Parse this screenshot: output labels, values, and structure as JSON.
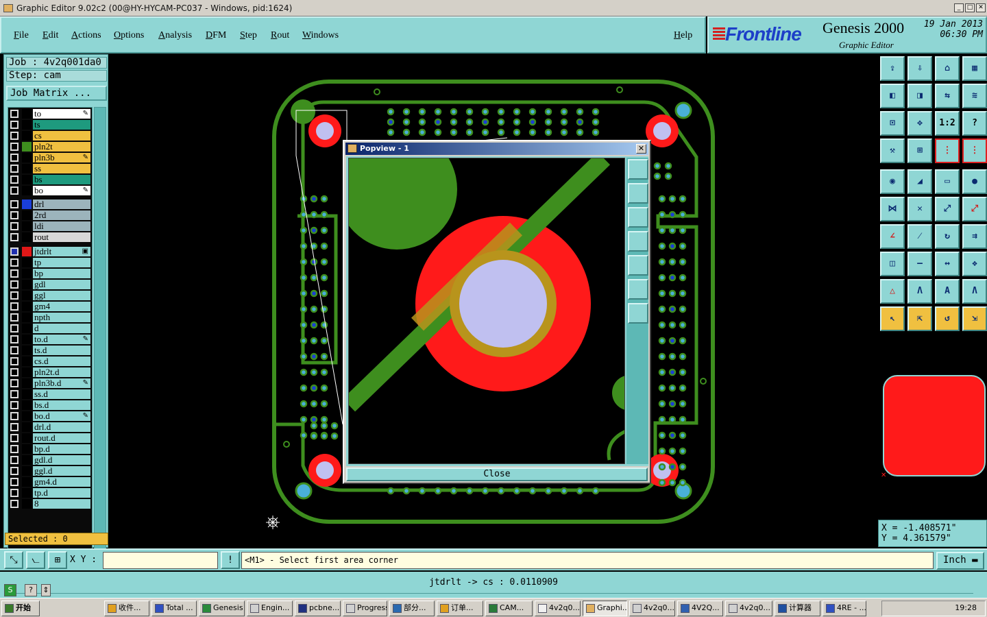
{
  "window": {
    "title": "Graphic Editor 9.02c2 (00@HY-HYCAM-PC037 - Windows, pid:1624)"
  },
  "menu": {
    "items": [
      "File",
      "Edit",
      "Actions",
      "Options",
      "Analysis",
      "DFM",
      "Step",
      "Rout",
      "Windows"
    ],
    "help": "Help"
  },
  "brand": {
    "logo": "Frontline",
    "product": "Genesis 2000",
    "subtitle": "Graphic Editor",
    "date": "19 Jan 2013",
    "time": "06:30 PM"
  },
  "job": {
    "job_label": "Job : 4v2q001da0",
    "step_label": "Step: cam",
    "matrix_button": "Job Matrix ..."
  },
  "layers": [
    {
      "name": "to",
      "color": "#ffffff",
      "mark": "pen"
    },
    {
      "name": "ts",
      "color": "#1e9a7e",
      "mark": ""
    },
    {
      "name": "cs",
      "color": "#f0c040",
      "mark": ""
    },
    {
      "name": "pln2t",
      "color": "#f0c040",
      "mark": "",
      "swatch": "#3e8e1e"
    },
    {
      "name": "pln3b",
      "color": "#f0c040",
      "mark": "pen"
    },
    {
      "name": "ss",
      "color": "#f0c040",
      "mark": ""
    },
    {
      "name": "bs",
      "color": "#1e9a7e",
      "mark": ""
    },
    {
      "name": "bo",
      "color": "#ffffff",
      "mark": "pen"
    },
    {
      "name": "drl",
      "color": "#9cb4bc",
      "mark": "",
      "swatch": "#1a3ed8"
    },
    {
      "name": "2rd",
      "color": "#9cb4bc",
      "mark": ""
    },
    {
      "name": "ldi",
      "color": "#9cb4bc",
      "mark": ""
    },
    {
      "name": "rout",
      "color": "#d8d8d8",
      "mark": ""
    },
    {
      "name": "jtdrlt",
      "color": "#8fd6d4",
      "mark": "box",
      "swatch": "#e01818",
      "checked": true
    },
    {
      "name": "tp",
      "color": "#8fd6d4",
      "mark": ""
    },
    {
      "name": "bp",
      "color": "#8fd6d4",
      "mark": ""
    },
    {
      "name": "gdl",
      "color": "#8fd6d4",
      "mark": ""
    },
    {
      "name": "ggl",
      "color": "#8fd6d4",
      "mark": ""
    },
    {
      "name": "gm4",
      "color": "#8fd6d4",
      "mark": ""
    },
    {
      "name": "npth",
      "color": "#8fd6d4",
      "mark": ""
    },
    {
      "name": "d",
      "color": "#8fd6d4",
      "mark": ""
    },
    {
      "name": "to.d",
      "color": "#8fd6d4",
      "mark": "pen"
    },
    {
      "name": "ts.d",
      "color": "#8fd6d4",
      "mark": ""
    },
    {
      "name": "cs.d",
      "color": "#8fd6d4",
      "mark": ""
    },
    {
      "name": "pln2t.d",
      "color": "#8fd6d4",
      "mark": ""
    },
    {
      "name": "pln3b.d",
      "color": "#8fd6d4",
      "mark": "pen"
    },
    {
      "name": "ss.d",
      "color": "#8fd6d4",
      "mark": ""
    },
    {
      "name": "bs.d",
      "color": "#8fd6d4",
      "mark": ""
    },
    {
      "name": "bo.d",
      "color": "#8fd6d4",
      "mark": "pen"
    },
    {
      "name": "drl.d",
      "color": "#8fd6d4",
      "mark": ""
    },
    {
      "name": "rout.d",
      "color": "#8fd6d4",
      "mark": ""
    },
    {
      "name": "bp.d",
      "color": "#8fd6d4",
      "mark": ""
    },
    {
      "name": "gdl.d",
      "color": "#8fd6d4",
      "mark": ""
    },
    {
      "name": "ggl.d",
      "color": "#8fd6d4",
      "mark": ""
    },
    {
      "name": "gm4.d",
      "color": "#8fd6d4",
      "mark": ""
    },
    {
      "name": "tp.d",
      "color": "#8fd6d4",
      "mark": ""
    },
    {
      "name": "8",
      "color": "#8fd6d4",
      "mark": ""
    }
  ],
  "selected": "Selected : 0",
  "popview": {
    "title": "Popview - 1",
    "close": "Close"
  },
  "toolbar": {
    "fit_label": "1:2",
    "help_label": "?"
  },
  "coords": {
    "x": "X = -1.408571\"",
    "y": "Y = 4.361579\""
  },
  "command": {
    "xy_label": "X Y :",
    "xy_value": "",
    "prompt": "<M1> - Select first area corner",
    "units": "Inch"
  },
  "status": {
    "measure": "jtdrlt -> cs : 0.0110909"
  },
  "taskbar": {
    "start": "开始",
    "tasks": [
      "收件...",
      "Total ...",
      "Genesis",
      "Engin...",
      "pcbne...",
      "Progress",
      "部分...",
      "订单...",
      "CAM...",
      "4v2q0...",
      "Graphi...",
      "4v2q0...",
      "4V2Q...",
      "4v2q0...",
      "计算器",
      "4RE - ..."
    ],
    "clock": "19:28"
  },
  "colors": {
    "panel": "#8fd6d4",
    "board_outline": "#3e8e1e",
    "pad_red": "#ff1a1a",
    "drill": "#c0c0f0",
    "via": "#4ab0d8",
    "highlight": "#f0c040"
  }
}
